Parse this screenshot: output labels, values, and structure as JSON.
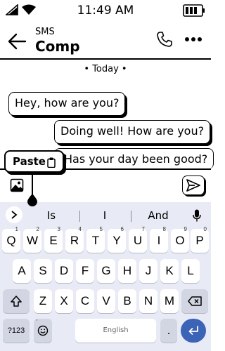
{
  "status": {
    "time": "11:49 AM"
  },
  "header": {
    "subtitle": "SMS",
    "title": "Comp"
  },
  "chat": {
    "date_label": "• Today •",
    "messages": [
      {
        "text": "Hey, how are you?",
        "direction": "incoming"
      },
      {
        "text": "Doing well! How are you?",
        "direction": "outgoing"
      },
      {
        "text": "Has your day been good?",
        "direction": "outgoing"
      }
    ]
  },
  "paste_popup": {
    "label": "Paste"
  },
  "keyboard": {
    "suggestions": [
      "Is",
      "I",
      "And"
    ],
    "row1": [
      {
        "key": "Q",
        "sub": "1"
      },
      {
        "key": "W",
        "sub": "2"
      },
      {
        "key": "E",
        "sub": "3"
      },
      {
        "key": "R",
        "sub": "4"
      },
      {
        "key": "T",
        "sub": "5"
      },
      {
        "key": "Y",
        "sub": "6"
      },
      {
        "key": "U",
        "sub": "7"
      },
      {
        "key": "I",
        "sub": "8"
      },
      {
        "key": "O",
        "sub": "9"
      },
      {
        "key": "P",
        "sub": "0"
      }
    ],
    "row2": [
      "A",
      "S",
      "D",
      "F",
      "G",
      "H",
      "J",
      "K",
      "L"
    ],
    "row3": [
      "Z",
      "X",
      "C",
      "V",
      "B",
      "N",
      "M"
    ],
    "symbols_label": "?123",
    "comma_label": ",",
    "space_label": "English",
    "period_label": "."
  },
  "colors": {
    "keyboard_bg": "#e8ebf5",
    "enter_key": "#3b63b6",
    "key_bg": "#ffffff"
  }
}
